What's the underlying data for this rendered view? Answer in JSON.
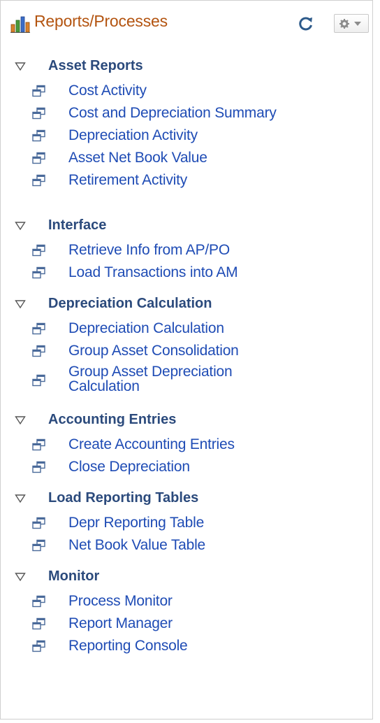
{
  "header": {
    "title": "Reports/Processes",
    "icon": "bar-chart-icon",
    "refresh_icon": "refresh-icon",
    "options_icon": "gear-icon"
  },
  "colors": {
    "title": "#b35410",
    "group_title": "#2b4a7c",
    "link": "#1f4cb5"
  },
  "groups": [
    {
      "title": "Asset Reports",
      "items": [
        "Cost Activity",
        "Cost and Depreciation Summary",
        "Depreciation Activity",
        "Asset Net Book Value",
        "Retirement Activity"
      ]
    },
    {
      "title": "Interface",
      "items": [
        "Retrieve Info from AP/PO",
        "Load Transactions into AM"
      ]
    },
    {
      "title": "Depreciation Calculation",
      "items": [
        "Depreciation Calculation",
        "Group Asset Consolidation",
        "Group Asset Depreciation Calculation"
      ]
    },
    {
      "title": "Accounting Entries",
      "items": [
        "Create Accounting Entries",
        "Close Depreciation"
      ]
    },
    {
      "title": "Load Reporting Tables",
      "items": [
        "Depr Reporting Table",
        "Net Book Value Table"
      ]
    },
    {
      "title": "Monitor",
      "items": [
        "Process Monitor",
        "Report Manager",
        "Reporting Console"
      ]
    }
  ]
}
